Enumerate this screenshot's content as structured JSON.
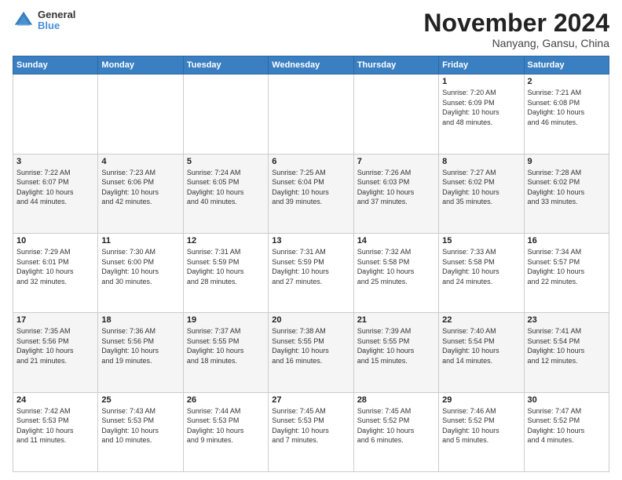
{
  "header": {
    "logo_line1": "General",
    "logo_line2": "Blue",
    "month": "November 2024",
    "location": "Nanyang, Gansu, China"
  },
  "days_of_week": [
    "Sunday",
    "Monday",
    "Tuesday",
    "Wednesday",
    "Thursday",
    "Friday",
    "Saturday"
  ],
  "weeks": [
    [
      {
        "day": "",
        "info": ""
      },
      {
        "day": "",
        "info": ""
      },
      {
        "day": "",
        "info": ""
      },
      {
        "day": "",
        "info": ""
      },
      {
        "day": "",
        "info": ""
      },
      {
        "day": "1",
        "info": "Sunrise: 7:20 AM\nSunset: 6:09 PM\nDaylight: 10 hours\nand 48 minutes."
      },
      {
        "day": "2",
        "info": "Sunrise: 7:21 AM\nSunset: 6:08 PM\nDaylight: 10 hours\nand 46 minutes."
      }
    ],
    [
      {
        "day": "3",
        "info": "Sunrise: 7:22 AM\nSunset: 6:07 PM\nDaylight: 10 hours\nand 44 minutes."
      },
      {
        "day": "4",
        "info": "Sunrise: 7:23 AM\nSunset: 6:06 PM\nDaylight: 10 hours\nand 42 minutes."
      },
      {
        "day": "5",
        "info": "Sunrise: 7:24 AM\nSunset: 6:05 PM\nDaylight: 10 hours\nand 40 minutes."
      },
      {
        "day": "6",
        "info": "Sunrise: 7:25 AM\nSunset: 6:04 PM\nDaylight: 10 hours\nand 39 minutes."
      },
      {
        "day": "7",
        "info": "Sunrise: 7:26 AM\nSunset: 6:03 PM\nDaylight: 10 hours\nand 37 minutes."
      },
      {
        "day": "8",
        "info": "Sunrise: 7:27 AM\nSunset: 6:02 PM\nDaylight: 10 hours\nand 35 minutes."
      },
      {
        "day": "9",
        "info": "Sunrise: 7:28 AM\nSunset: 6:02 PM\nDaylight: 10 hours\nand 33 minutes."
      }
    ],
    [
      {
        "day": "10",
        "info": "Sunrise: 7:29 AM\nSunset: 6:01 PM\nDaylight: 10 hours\nand 32 minutes."
      },
      {
        "day": "11",
        "info": "Sunrise: 7:30 AM\nSunset: 6:00 PM\nDaylight: 10 hours\nand 30 minutes."
      },
      {
        "day": "12",
        "info": "Sunrise: 7:31 AM\nSunset: 5:59 PM\nDaylight: 10 hours\nand 28 minutes."
      },
      {
        "day": "13",
        "info": "Sunrise: 7:31 AM\nSunset: 5:59 PM\nDaylight: 10 hours\nand 27 minutes."
      },
      {
        "day": "14",
        "info": "Sunrise: 7:32 AM\nSunset: 5:58 PM\nDaylight: 10 hours\nand 25 minutes."
      },
      {
        "day": "15",
        "info": "Sunrise: 7:33 AM\nSunset: 5:58 PM\nDaylight: 10 hours\nand 24 minutes."
      },
      {
        "day": "16",
        "info": "Sunrise: 7:34 AM\nSunset: 5:57 PM\nDaylight: 10 hours\nand 22 minutes."
      }
    ],
    [
      {
        "day": "17",
        "info": "Sunrise: 7:35 AM\nSunset: 5:56 PM\nDaylight: 10 hours\nand 21 minutes."
      },
      {
        "day": "18",
        "info": "Sunrise: 7:36 AM\nSunset: 5:56 PM\nDaylight: 10 hours\nand 19 minutes."
      },
      {
        "day": "19",
        "info": "Sunrise: 7:37 AM\nSunset: 5:55 PM\nDaylight: 10 hours\nand 18 minutes."
      },
      {
        "day": "20",
        "info": "Sunrise: 7:38 AM\nSunset: 5:55 PM\nDaylight: 10 hours\nand 16 minutes."
      },
      {
        "day": "21",
        "info": "Sunrise: 7:39 AM\nSunset: 5:55 PM\nDaylight: 10 hours\nand 15 minutes."
      },
      {
        "day": "22",
        "info": "Sunrise: 7:40 AM\nSunset: 5:54 PM\nDaylight: 10 hours\nand 14 minutes."
      },
      {
        "day": "23",
        "info": "Sunrise: 7:41 AM\nSunset: 5:54 PM\nDaylight: 10 hours\nand 12 minutes."
      }
    ],
    [
      {
        "day": "24",
        "info": "Sunrise: 7:42 AM\nSunset: 5:53 PM\nDaylight: 10 hours\nand 11 minutes."
      },
      {
        "day": "25",
        "info": "Sunrise: 7:43 AM\nSunset: 5:53 PM\nDaylight: 10 hours\nand 10 minutes."
      },
      {
        "day": "26",
        "info": "Sunrise: 7:44 AM\nSunset: 5:53 PM\nDaylight: 10 hours\nand 9 minutes."
      },
      {
        "day": "27",
        "info": "Sunrise: 7:45 AM\nSunset: 5:53 PM\nDaylight: 10 hours\nand 7 minutes."
      },
      {
        "day": "28",
        "info": "Sunrise: 7:45 AM\nSunset: 5:52 PM\nDaylight: 10 hours\nand 6 minutes."
      },
      {
        "day": "29",
        "info": "Sunrise: 7:46 AM\nSunset: 5:52 PM\nDaylight: 10 hours\nand 5 minutes."
      },
      {
        "day": "30",
        "info": "Sunrise: 7:47 AM\nSunset: 5:52 PM\nDaylight: 10 hours\nand 4 minutes."
      }
    ]
  ]
}
